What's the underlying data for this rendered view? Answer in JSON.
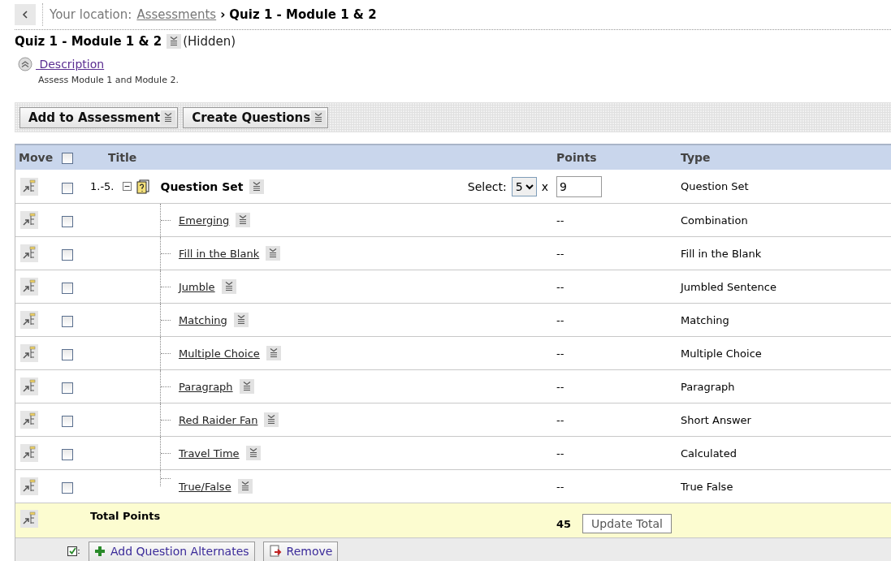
{
  "breadcrumb": {
    "label": "Your location:",
    "link": "Assessments",
    "separator": "›",
    "current": "Quiz 1 - Module 1 & 2"
  },
  "title": "Quiz 1 - Module 1 & 2",
  "visibility": "(Hidden)",
  "description": {
    "link": "Description",
    "text": "Assess Module 1 and Module 2.",
    "expanded": true
  },
  "toolbar": [
    "Add to Assessment",
    "Create Questions"
  ],
  "table": {
    "columns": [
      "Move",
      "Title",
      "Points",
      "Type"
    ],
    "header_checked": false,
    "question_set": {
      "number": "1.-5.",
      "title": "Question Set",
      "select_label": "Select:",
      "select_value": "5",
      "times": "x",
      "points": "9",
      "type": "Question Set",
      "checked": false,
      "expanded": true
    },
    "rows": [
      {
        "title": "Emerging",
        "points": "--",
        "type": "Combination",
        "checked": false
      },
      {
        "title": "Fill in the Blank",
        "points": "--",
        "type": "Fill in the Blank",
        "checked": false
      },
      {
        "title": "Jumble",
        "points": "--",
        "type": "Jumbled Sentence",
        "checked": false
      },
      {
        "title": "Matching",
        "points": "--",
        "type": "Matching",
        "checked": false
      },
      {
        "title": "Multiple Choice",
        "points": "--",
        "type": "Multiple Choice",
        "checked": false
      },
      {
        "title": "Paragraph",
        "points": "--",
        "type": "Paragraph",
        "checked": false
      },
      {
        "title": "Red Raider Fan",
        "points": "--",
        "type": "Short Answer",
        "checked": false
      },
      {
        "title": "Travel Time",
        "points": "--",
        "type": "Calculated",
        "checked": false
      },
      {
        "title": "True/False",
        "points": "--",
        "type": "True False",
        "checked": false
      }
    ],
    "total": {
      "label": "Total Points",
      "points": "45",
      "button": "Update Total"
    }
  },
  "footer": {
    "buttons": [
      "Add Question Alternates",
      "Remove"
    ]
  }
}
